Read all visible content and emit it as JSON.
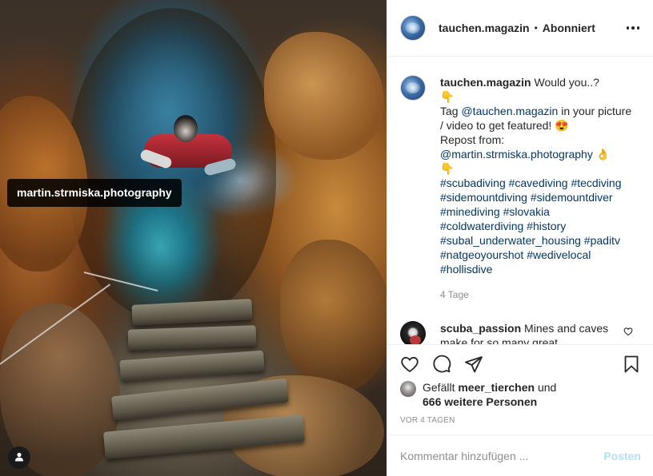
{
  "image": {
    "tagged_user": "martin.strmiska.photography",
    "user_tag_icon": "person-icon"
  },
  "header": {
    "username": "tauchen.magazin",
    "separator": "•",
    "follow_status": "Abonniert",
    "more_icon": "ellipsis-icon"
  },
  "caption": {
    "username": "tauchen.magazin",
    "lines": [
      "Would you..?",
      "👇",
      "Tag",
      "@tauchen.magazin",
      "in your picture / video to get featured! 😍",
      "Repost from:",
      "@martin.strmiska.photography",
      "👌",
      "👇",
      "#scubadiving #cavediving #tecdiving",
      "#sidemountdiving #sidemountdiver",
      "#minediving #slovakia",
      "#coldwaterdiving #history",
      "#subal_underwater_housing #paditv",
      "#natgeoyourshot #wedivelocal",
      "#hollisdive"
    ],
    "time": "4 Tage"
  },
  "comment": {
    "username": "scuba_passion",
    "text": "Mines and caves make for so many great"
  },
  "actions": {
    "like_icon": "heart-icon",
    "comment_icon": "comment-icon",
    "share_icon": "share-icon",
    "save_icon": "bookmark-icon"
  },
  "likes": {
    "prefix": "Gefällt",
    "user": "meer_tierchen",
    "connector": "und",
    "others": "666 weitere Personen"
  },
  "date": "VOR 4 TAGEN",
  "add_comment": {
    "placeholder": "Kommentar hinzufügen ...",
    "post_label": "Posten"
  },
  "colors": {
    "link": "#00376b",
    "muted": "#8e8e8e",
    "post_button_disabled": "#b2dffc",
    "border": "#efefef"
  }
}
